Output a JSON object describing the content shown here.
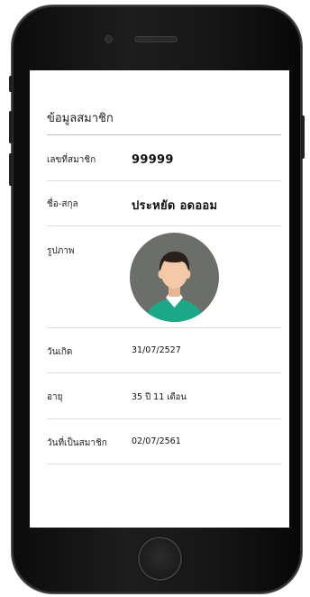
{
  "page": {
    "title": "ข้อมูลสมาชิก"
  },
  "member": {
    "id": {
      "label": "เลขที่สมาชิก",
      "value": "99999"
    },
    "name": {
      "label": "ชื่อ-สกุล",
      "value": "ประหยัด อดออม"
    },
    "photo": {
      "label": "รูปภาพ",
      "icon": "user-avatar-icon"
    },
    "birthdate": {
      "label": "วันเกิด",
      "value": "31/07/2527"
    },
    "age": {
      "label": "อายุ",
      "value": "35 ปี 11 เดือน"
    },
    "member_since": {
      "label": "วันที่เป็นสมาชิก",
      "value": "02/07/2561"
    }
  },
  "colors": {
    "avatar_background": "#6b6e69",
    "shirt": "#1aa889",
    "hair": "#2b1f1a",
    "skin": "#f3c9a7"
  }
}
